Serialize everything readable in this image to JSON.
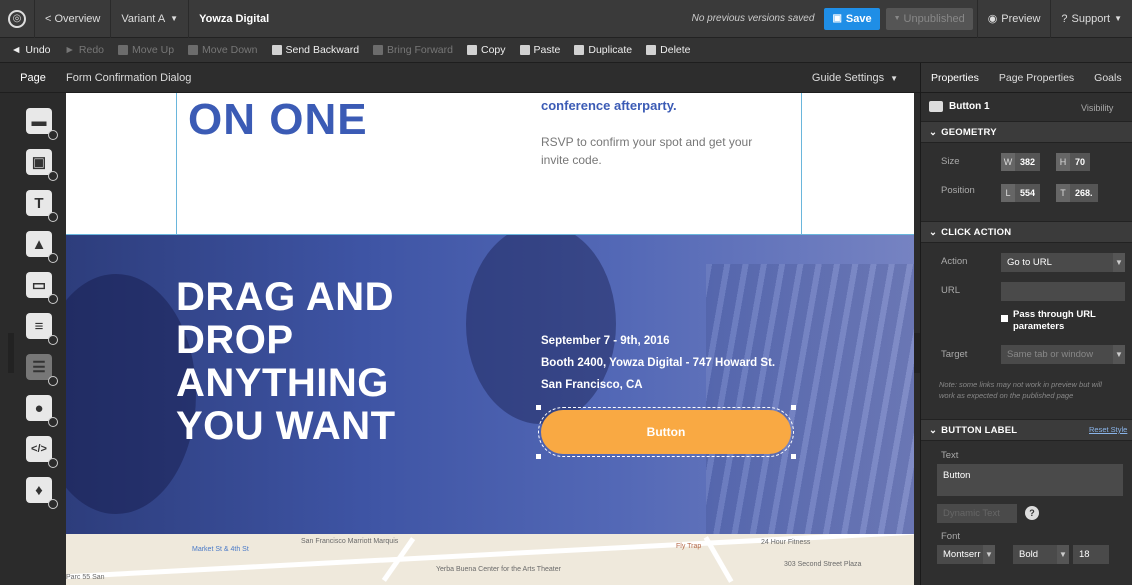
{
  "topbar": {
    "overview": "< Overview",
    "variant": "Variant A",
    "page_name": "Yowza Digital",
    "status_note": "No previous versions saved",
    "save": "Save",
    "unpublished": "Unpublished",
    "preview": "Preview",
    "support": "Support"
  },
  "toolbar": {
    "undo": "Undo",
    "redo": "Redo",
    "move_up": "Move Up",
    "move_down": "Move Down",
    "send_backward": "Send Backward",
    "bring_forward": "Bring Forward",
    "copy": "Copy",
    "paste": "Paste",
    "duplicate": "Duplicate",
    "delete": "Delete"
  },
  "pagehead": {
    "tab": "Page",
    "title": "Form Confirmation Dialog",
    "guide": "Guide Settings"
  },
  "canvas": {
    "heading_top": "ON ONE",
    "party_text": "conference afterparty.",
    "rsvp_line1": "RSVP to confirm your spot and get your",
    "rsvp_line2": "invite code.",
    "hero_l1": "DRAG AND",
    "hero_l2": "DROP",
    "hero_l3": "ANYTHING",
    "hero_l4": "YOU WANT",
    "event_date": "September 7 - 9th, 2016",
    "event_booth": "Booth 2400, Yowza Digital - 747 Howard St.",
    "event_city": "San Francisco, CA",
    "button": "Button",
    "map": {
      "l1": "San Francisco Marriott Marquis",
      "l2": "Market St & 4th St",
      "l3": "Yerba Buena Center for the Arts Theater",
      "l4": "Fly Trap",
      "l5": "24 Hour Fitness",
      "l6": "303 Second Street Plaza",
      "l7": "Parc 55 San"
    }
  },
  "panel": {
    "tabs": [
      "Properties",
      "Page Properties",
      "Goals"
    ],
    "element": "Button 1",
    "visibility": "Visibility",
    "geometry": {
      "title": "GEOMETRY",
      "size_label": "Size",
      "position_label": "Position",
      "w_key": "W",
      "w": "382",
      "h_key": "H",
      "h": "70",
      "l_key": "L",
      "l": "554",
      "t_key": "T",
      "t": "268."
    },
    "click": {
      "title": "CLICK ACTION",
      "action_label": "Action",
      "action": "Go to URL",
      "url_label": "URL",
      "pass_line1": "Pass through URL",
      "pass_line2": "parameters",
      "target_label": "Target",
      "target": "Same tab or window",
      "note_line1": "Note: some links may not work in preview but will",
      "note_line2": "work as expected on the published page"
    },
    "label": {
      "title": "BUTTON LABEL",
      "reset": "Reset Style",
      "text_label": "Text",
      "text": "Button",
      "dynamic": "Dynamic Text",
      "font_label": "Font",
      "font": "Montserr",
      "weight": "Bold",
      "size": "18"
    }
  }
}
